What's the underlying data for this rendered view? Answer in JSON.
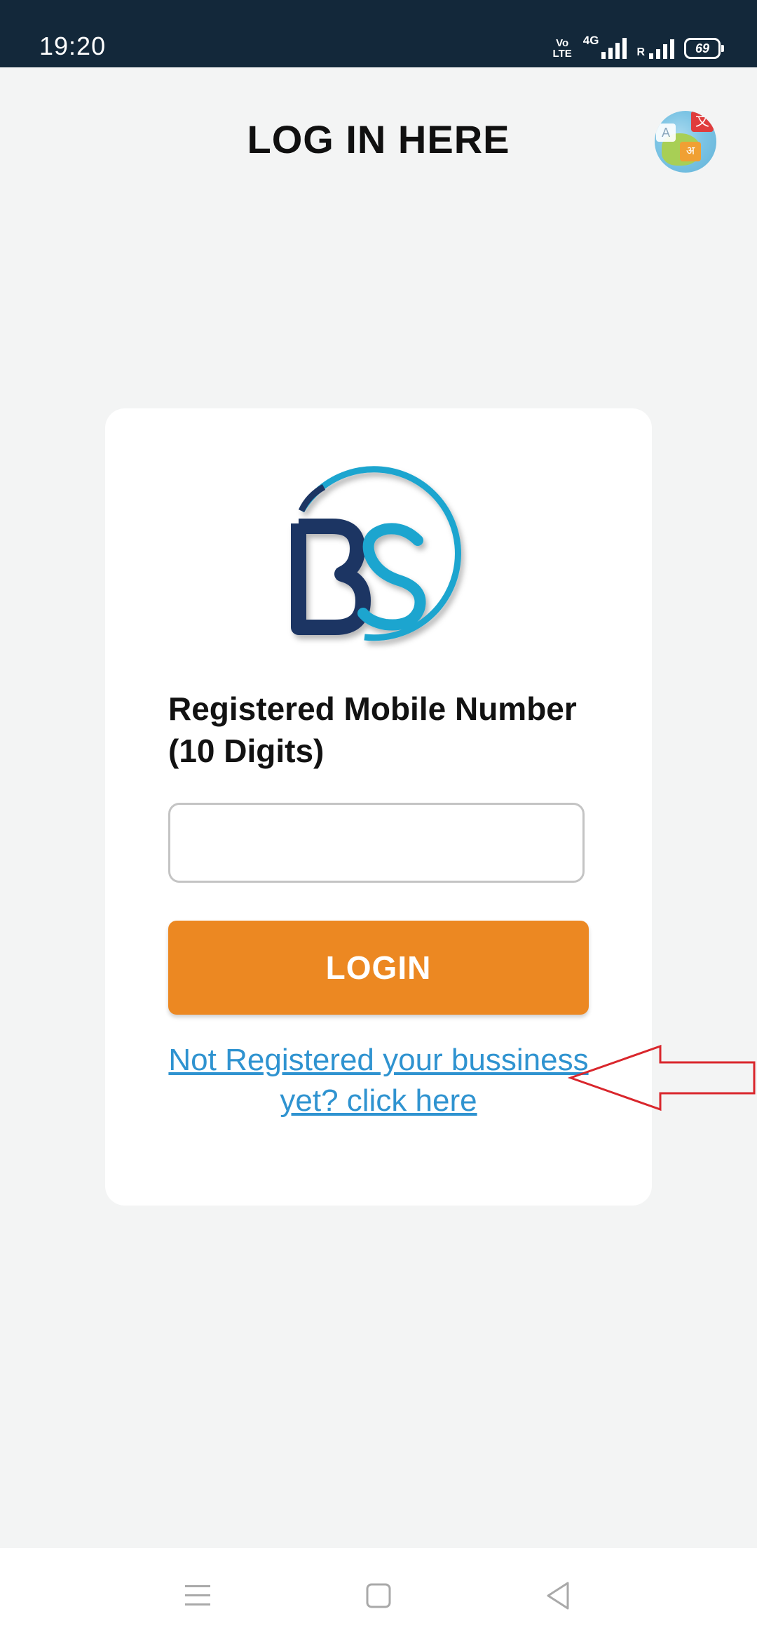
{
  "status_bar": {
    "time": "19:20",
    "volte_top": "Vo",
    "volte_bottom": "LTE",
    "network_type": "4G",
    "roaming": "R",
    "battery": "69"
  },
  "header": {
    "title": "LOG IN HERE",
    "language_icon": "translate-globe-icon",
    "language_glyphs": {
      "a": "A",
      "red": "文",
      "orange": "अ"
    }
  },
  "login_card": {
    "logo_text": "BS",
    "field_label": "Registered Mobile Number (10 Digits)",
    "mobile_input": {
      "value": "",
      "placeholder": ""
    },
    "login_button": "LOGIN",
    "register_link": "Not Registered your bussiness yet? click here"
  },
  "navigation_bar": {
    "icons": [
      "menu-icon",
      "home-icon",
      "back-icon"
    ]
  },
  "colors": {
    "status_bar": "#13283a",
    "background": "#f3f4f4",
    "button": "#ec8822",
    "link": "#2f93d0",
    "annotation_arrow": "#d9262c",
    "logo_navy": "#1d3563",
    "logo_cyan": "#1ea5cf"
  }
}
